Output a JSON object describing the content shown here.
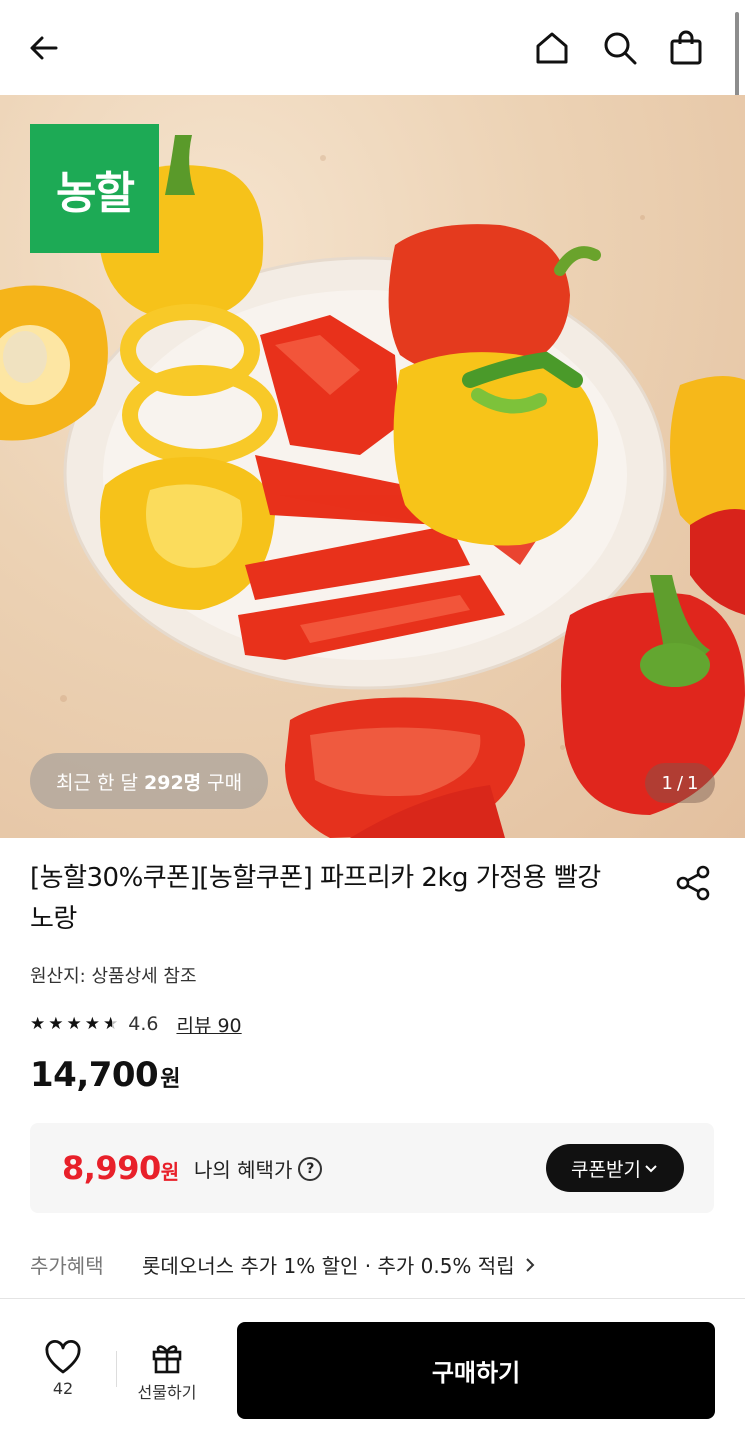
{
  "header": {
    "back_icon": "arrow-left-icon",
    "home_icon": "home-icon",
    "search_icon": "search-icon",
    "cart_icon": "shopping-bag-icon"
  },
  "hero": {
    "brand_badge": "농할",
    "buyers_prefix": "최근 한 달",
    "buyers_count": "292명",
    "buyers_suffix": "구매",
    "page_current": "1",
    "page_sep": "/",
    "page_total": "1"
  },
  "product": {
    "title": "[농할30%쿠폰][농할쿠폰] 파프리카 2kg 가정용 빨강 노랑",
    "origin": "원산지: 상품상세 참조",
    "rating": 4.6,
    "rating_text": "4.6",
    "review_label": "리뷰 90",
    "price": "14,700",
    "price_unit": "원"
  },
  "benefit": {
    "price": "8,990",
    "price_unit": "원",
    "label": "나의 혜택가",
    "coupon_button": "쿠폰받기"
  },
  "extra": {
    "label": "추가혜택",
    "text": "롯데오너스 추가 1% 할인 · 추가 0.5% 적립"
  },
  "bottom": {
    "like_count": "42",
    "gift_label": "선물하기",
    "buy_label": "구매하기"
  },
  "colors": {
    "accent_red": "#e8202a",
    "brand_green": "#1daa55",
    "button_black": "#000000"
  }
}
